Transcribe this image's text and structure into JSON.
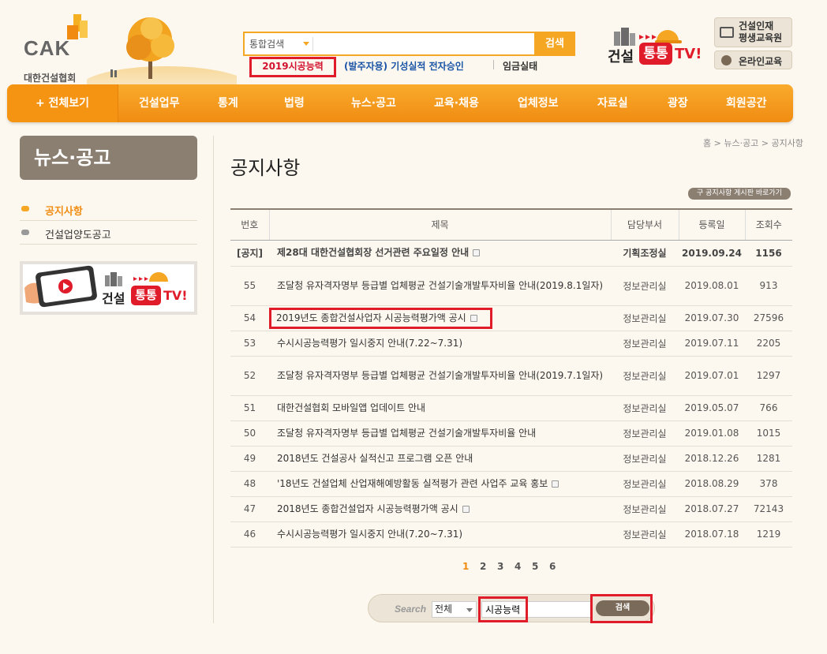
{
  "header": {
    "logo_text": "CAK",
    "logo_org": "대한건설협회",
    "search": {
      "scope": "통합검색",
      "placeholder": "",
      "button": "검색"
    },
    "quick_links": [
      "2019시공능력",
      "(발주자용) 기성실적 전자승인",
      "임금실태"
    ],
    "tv_label_left": "건설",
    "tv_label_mid": "통통",
    "tv_label_right": "TV!",
    "side_buttons": {
      "edu_line1": "건설인재",
      "edu_line2": "평생교육원",
      "online": "온라인교육"
    }
  },
  "nav": {
    "all": "+ 전체보기",
    "items": [
      "건설업무",
      "통계",
      "법령",
      "뉴스·공고",
      "교육·채용",
      "업체정보",
      "자료실",
      "광장",
      "회원공간"
    ]
  },
  "sidebar": {
    "title": "뉴스·공고",
    "items": [
      {
        "label": "공지사항",
        "active": true
      },
      {
        "label": "건설업양도공고",
        "active": false
      }
    ]
  },
  "breadcrumb": "홈 > 뉴스·공고 > 공지사항",
  "page_title": "공지사항",
  "old_board_button": "구 공지사항 게시판 바로가기",
  "table": {
    "columns": [
      "번호",
      "제목",
      "담당부서",
      "등록일",
      "조회수"
    ],
    "notice": {
      "no": "[공지]",
      "title": "제28대 대한건설협회장 선거관련 주요일정 안내",
      "dept": "기획조정실",
      "date": "2019.09.24",
      "views": "1156"
    },
    "rows": [
      {
        "no": "55",
        "title": "조달청 유자격자명부 등급별 업체평균 건설기술개발투자비율 안내(2019.8.1일자)",
        "dept": "정보관리실",
        "date": "2019.08.01",
        "views": "913"
      },
      {
        "no": "54",
        "title": "2019년도 종합건설사업자 시공능력평가액 공시",
        "dept": "정보관리실",
        "date": "2019.07.30",
        "views": "27596"
      },
      {
        "no": "53",
        "title": "수시시공능력평가 일시중지 안내(7.22~7.31)",
        "dept": "정보관리실",
        "date": "2019.07.11",
        "views": "2205"
      },
      {
        "no": "52",
        "title": "조달청 유자격자명부 등급별 업체평균 건설기술개발투자비율 안내(2019.7.1일자)",
        "dept": "정보관리실",
        "date": "2019.07.01",
        "views": "1297"
      },
      {
        "no": "51",
        "title": "대한건설협회 모바일앱 업데이트 안내",
        "dept": "정보관리실",
        "date": "2019.05.07",
        "views": "766"
      },
      {
        "no": "50",
        "title": "조달청 유자격자명부 등급별 업체평균 건설기술개발투자비율 안내",
        "dept": "정보관리실",
        "date": "2019.01.08",
        "views": "1015"
      },
      {
        "no": "49",
        "title": "2018년도 건설공사 실적신고 프로그램 오픈 안내",
        "dept": "정보관리실",
        "date": "2018.12.26",
        "views": "1281"
      },
      {
        "no": "48",
        "title": "'18년도 건설업체 산업재해예방활동 실적평가 관련 사업주 교육 홍보",
        "dept": "정보관리실",
        "date": "2018.08.29",
        "views": "378"
      },
      {
        "no": "47",
        "title": "2018년도 종합건설업자 시공능력평가액 공시",
        "dept": "정보관리실",
        "date": "2018.07.27",
        "views": "72143"
      },
      {
        "no": "46",
        "title": "수시시공능력평가 일시중지 안내(7.20~7.31)",
        "dept": "정보관리실",
        "date": "2018.07.18",
        "views": "1219"
      }
    ]
  },
  "pagination": {
    "pages": [
      "1",
      "2",
      "3",
      "4",
      "5",
      "6"
    ],
    "current": "1"
  },
  "bottom_search": {
    "label": "Search",
    "scope": "전체",
    "query": "시공능력",
    "button": "검색"
  }
}
